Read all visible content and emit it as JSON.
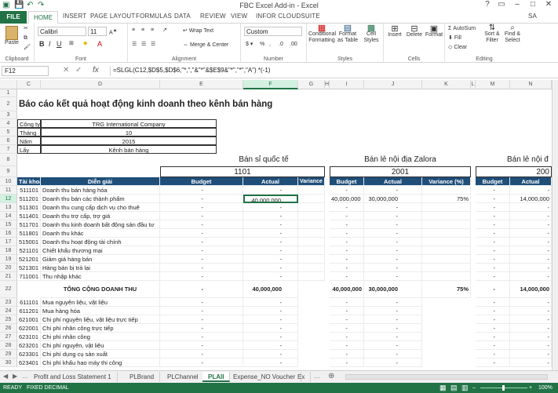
{
  "window": {
    "title": "FBC Excel Add-in - Excel",
    "user": "SA"
  },
  "ribbon_tabs": [
    "FILE",
    "HOME",
    "INSERT",
    "PAGE LAYOUT",
    "FORMULAS",
    "DATA",
    "REVIEW",
    "VIEW",
    "INFOR CLOUDSUITE"
  ],
  "ribbon": {
    "clipboard": {
      "label": "Clipboard",
      "paste": "Paste"
    },
    "font": {
      "label": "Font",
      "name": "Calibri",
      "size": "11"
    },
    "alignment": {
      "label": "Alignment",
      "wrap": "Wrap Text",
      "merge": "Merge & Center"
    },
    "number": {
      "label": "Number",
      "format": "Custom"
    },
    "styles": {
      "label": "Styles",
      "conditional": "Conditional Formatting",
      "format_table": "Format as Table",
      "cell_styles": "Cell Styles"
    },
    "cells": {
      "label": "Cells",
      "insert": "Insert",
      "delete": "Delete",
      "format": "Format"
    },
    "editing": {
      "label": "Editing",
      "autosum": "AutoSum",
      "fill": "Fill",
      "clear": "Clear",
      "sort": "Sort & Filter",
      "find": "Find & Select"
    }
  },
  "formula_bar": {
    "name_box": "F12",
    "formula": "=SLGL(C12,$D$5,$D$6,\"*,\",\"&\"*\"&$E$9&\"*\",\"*\",\"A\") *(-1)"
  },
  "columns": [
    "C",
    "D",
    "E",
    "F",
    "G",
    "H",
    "I",
    "J",
    "K",
    "L",
    "M",
    "N"
  ],
  "sheet": {
    "title": "Báo cáo kết quả hoạt động kinh doanh theo kênh bán hàng",
    "params": [
      {
        "label": "Công ty",
        "value": "TRG International Company"
      },
      {
        "label": "Tháng",
        "value": "10"
      },
      {
        "label": "Năm",
        "value": "2015"
      },
      {
        "label": "Lấy",
        "value": "Kênh bán hàng"
      }
    ],
    "channels": [
      {
        "name": "Bán sỉ quốc tế",
        "code": "1101"
      },
      {
        "name": "Bán lẻ nội địa Zalora",
        "code": "2001"
      },
      {
        "name": "Bán lẻ nội đ",
        "code": "200"
      }
    ],
    "headers": {
      "account": "Tài khoản",
      "desc": "Diễn giải",
      "budget": "Budget",
      "actual": "Actual",
      "variance": "Variance (%)"
    },
    "rows": [
      {
        "n": "11",
        "acct": "511101",
        "desc": "Doanh thu bán hàng hóa",
        "e": "-",
        "f": "-",
        "g": "",
        "i": "-",
        "j": "-",
        "k": "",
        "m": "-",
        "n2": "-"
      },
      {
        "n": "12",
        "acct": "511201",
        "desc": "Doanh thu bán các thành phẩm",
        "e": "-",
        "f": "40,000,000",
        "g": "",
        "i": "40,000,000",
        "j": "30,000,000",
        "k": "75%",
        "m": "-",
        "n2": "14,000,000"
      },
      {
        "n": "13",
        "acct": "511301",
        "desc": "Doanh thu cung cấp dịch vụ cho thuê",
        "e": "-",
        "f": "-",
        "g": "",
        "i": "-",
        "j": "-",
        "k": "",
        "m": "-",
        "n2": "-"
      },
      {
        "n": "14",
        "acct": "511401",
        "desc": "Doanh thu trợ cấp, trợ giá",
        "e": "-",
        "f": "-",
        "g": "",
        "i": "-",
        "j": "-",
        "k": "",
        "m": "-",
        "n2": "-"
      },
      {
        "n": "15",
        "acct": "511701",
        "desc": "Doanh thu kinh doanh bất động sản đầu tư",
        "e": "-",
        "f": "-",
        "g": "",
        "i": "-",
        "j": "-",
        "k": "",
        "m": "-",
        "n2": "-"
      },
      {
        "n": "16",
        "acct": "511801",
        "desc": "Doanh thu khác",
        "e": "-",
        "f": "-",
        "g": "",
        "i": "-",
        "j": "-",
        "k": "",
        "m": "-",
        "n2": "-"
      },
      {
        "n": "17",
        "acct": "515001",
        "desc": "Doanh thu hoạt động tài chính",
        "e": "-",
        "f": "-",
        "g": "",
        "i": "-",
        "j": "-",
        "k": "",
        "m": "-",
        "n2": "-"
      },
      {
        "n": "18",
        "acct": "521101",
        "desc": "Chiết khấu thương mại",
        "e": "-",
        "f": "-",
        "g": "",
        "i": "-",
        "j": "-",
        "k": "",
        "m": "-",
        "n2": "-"
      },
      {
        "n": "19",
        "acct": "521201",
        "desc": "Giảm giá hàng bán",
        "e": "-",
        "f": "-",
        "g": "",
        "i": "-",
        "j": "-",
        "k": "",
        "m": "-",
        "n2": "-"
      },
      {
        "n": "20",
        "acct": "521301",
        "desc": "Hàng bán bị trả lại",
        "e": "-",
        "f": "-",
        "g": "",
        "i": "-",
        "j": "-",
        "k": "",
        "m": "-",
        "n2": "-"
      },
      {
        "n": "21",
        "acct": "711001",
        "desc": "Thu nhập khác",
        "e": "-",
        "f": "-",
        "g": "",
        "i": "-",
        "j": "-",
        "k": "",
        "m": "-",
        "n2": "-"
      }
    ],
    "total": {
      "n": "22",
      "label": "TỔNG CỘNG DOANH THU",
      "e": "-",
      "f": "40,000,000",
      "i": "40,000,000",
      "j": "30,000,000",
      "k": "75%",
      "m": "-",
      "n2": "14,000,000"
    },
    "rows2": [
      {
        "n": "23",
        "acct": "611101",
        "desc": "Mua nguyên liệu, vật liệu",
        "e": "-",
        "f": "-",
        "i": "-",
        "j": "-",
        "m": "-",
        "n2": "-"
      },
      {
        "n": "24",
        "acct": "611201",
        "desc": "Mua hàng hóa",
        "e": "-",
        "f": "-",
        "i": "-",
        "j": "-",
        "m": "-",
        "n2": "-"
      },
      {
        "n": "25",
        "acct": "621001",
        "desc": "Chi phí nguyên liệu, vật liệu trực tiếp",
        "e": "-",
        "f": "-",
        "i": "-",
        "j": "-",
        "m": "-",
        "n2": "-"
      },
      {
        "n": "26",
        "acct": "622001",
        "desc": "Chi phí nhân công trực tiếp",
        "e": "-",
        "f": "-",
        "i": "-",
        "j": "-",
        "m": "-",
        "n2": "-"
      },
      {
        "n": "27",
        "acct": "623101",
        "desc": "Chi phí nhân công",
        "e": "-",
        "f": "-",
        "i": "-",
        "j": "-",
        "m": "-",
        "n2": "-"
      },
      {
        "n": "28",
        "acct": "623201",
        "desc": "Chi phí nguyên, vật liệu",
        "e": "-",
        "f": "-",
        "i": "-",
        "j": "-",
        "m": "-",
        "n2": "-"
      },
      {
        "n": "29",
        "acct": "623301",
        "desc": "Chi phí dụng cụ sản xuất",
        "e": "-",
        "f": "-",
        "i": "-",
        "j": "-",
        "m": "-",
        "n2": "-"
      },
      {
        "n": "30",
        "acct": "623401",
        "desc": "Chi phí khấu hao máy thi công",
        "e": "-",
        "f": "-",
        "i": "-",
        "j": "-",
        "m": "-",
        "n2": "-"
      }
    ]
  },
  "sheet_tabs": [
    "Profit and Loss Statement 1",
    "PLBrand",
    "PLChannel",
    "PLAII",
    "Expense_NO Voucher",
    "Ex"
  ],
  "status": {
    "ready": "READY",
    "fixed": "FIXED DECIMAL",
    "zoom": "100%"
  },
  "colors": {
    "excel_green": "#217346",
    "header_blue": "#1f4e79"
  }
}
